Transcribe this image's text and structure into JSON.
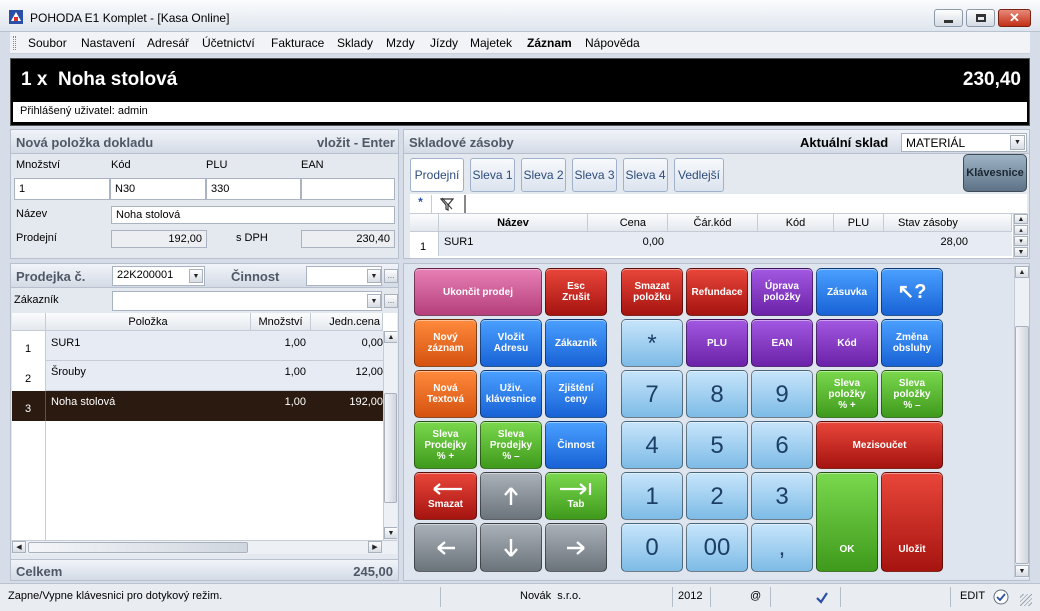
{
  "window": {
    "title": "POHODA E1 Komplet - [Kasa Online]"
  },
  "menu": [
    "Soubor",
    "Nastavení",
    "Adresář",
    "Účetnictví",
    "Fakturace",
    "Sklady",
    "Mzdy",
    "Jízdy",
    "Majetek",
    "Záznam",
    "Nápověda"
  ],
  "display": {
    "product": "1 x  Noha stolová",
    "total": "230,40",
    "user": "Přihlášený uživatel: admin"
  },
  "item_form": {
    "title": "Nová položka dokladu",
    "hint": "vložit - Enter",
    "mnozstvi_label": "Množství",
    "kod_label": "Kód",
    "plu_label": "PLU",
    "ean_label": "EAN",
    "mnozstvi": "1",
    "kod": "N30",
    "plu": "330",
    "ean": "",
    "nazev_label": "Název",
    "nazev": "Noha stolová",
    "prodejni_label": "Prodejní",
    "prodejni": "192,00",
    "sdph_label": "s DPH",
    "sdph": "230,40"
  },
  "sale": {
    "prodejka_label": "Prodejka č.",
    "prodejka": "22K200001",
    "cinnost_label": "Činnost",
    "cinnost": "",
    "zakaznik_label": "Zákazník",
    "zakaznik": "",
    "cols": [
      "Položka",
      "Množství",
      "Jedn.cena"
    ],
    "rows": [
      {
        "n": "1",
        "name": "SUR1",
        "qty": "1,00",
        "price": "0,00"
      },
      {
        "n": "2",
        "name": "Šrouby",
        "qty": "1,00",
        "price": "12,00"
      },
      {
        "n": "3",
        "name": "Noha stolová",
        "qty": "1,00",
        "price": "192,00"
      }
    ],
    "celkem_label": "Celkem",
    "celkem": "245,00"
  },
  "stock": {
    "title": "Skladové zásoby",
    "sklad_label": "Aktuální sklad",
    "sklad": "MATERIÁL",
    "tabs": [
      "Prodejní",
      "Sleva 1",
      "Sleva 2",
      "Sleva 3",
      "Sleva 4",
      "Vedlejší"
    ],
    "klavesnice": "Klávesnice",
    "filter_star": "*",
    "cols": [
      "Název",
      "Cena",
      "Čár.kód",
      "Kód",
      "PLU",
      "Stav zásoby"
    ],
    "row": {
      "n": "1",
      "name": "SUR1",
      "cena": "0,00",
      "carkod": "",
      "kod": "",
      "plu": "",
      "stav": "28,00"
    }
  },
  "keys": {
    "ukoncit": "Ukončit prodej",
    "esc": "Esc",
    "zrusit": "Zrušit",
    "smazat_pol": "Smazat položku",
    "refundace": "Refundace",
    "uprava": "Úprava položky",
    "zasuvka": "Zásuvka",
    "help": "↖?",
    "novy": "Nový záznam",
    "vlozit": "Vložit Adresu",
    "zakaznik": "Zákazník",
    "star": "*",
    "plu": "PLU",
    "ean": "EAN",
    "kod": "Kód",
    "zmena": "Změna obsluhy",
    "textova": "Nová Textová",
    "uziv": "Uživ. klávesnice",
    "zjisteni": "Zjištění ceny",
    "n7": "7",
    "n8": "8",
    "n9": "9",
    "slevapol_plus": "Sleva položky % +",
    "slevapol_minus": "Sleva položky % –",
    "slevaprod_plus": "Sleva Prodejky % +",
    "slevaprod_minus": "Sleva Prodejky % –",
    "cinnost": "Činnost",
    "n4": "4",
    "n5": "5",
    "n6": "6",
    "mezisoucet": "Mezisoučet",
    "smazat": "Smazat",
    "tab": "Tab",
    "n1": "1",
    "n2": "2",
    "n3": "3",
    "ok": "OK",
    "ulozit": "Uložit",
    "n0": "0",
    "n00": "00",
    "comma": ","
  },
  "status": {
    "message": "Zapne/Vypne klávesnici pro dotykový režim.",
    "company": "Novák  s.r.o.",
    "year": "2012",
    "at": "@",
    "mode": "EDIT"
  }
}
